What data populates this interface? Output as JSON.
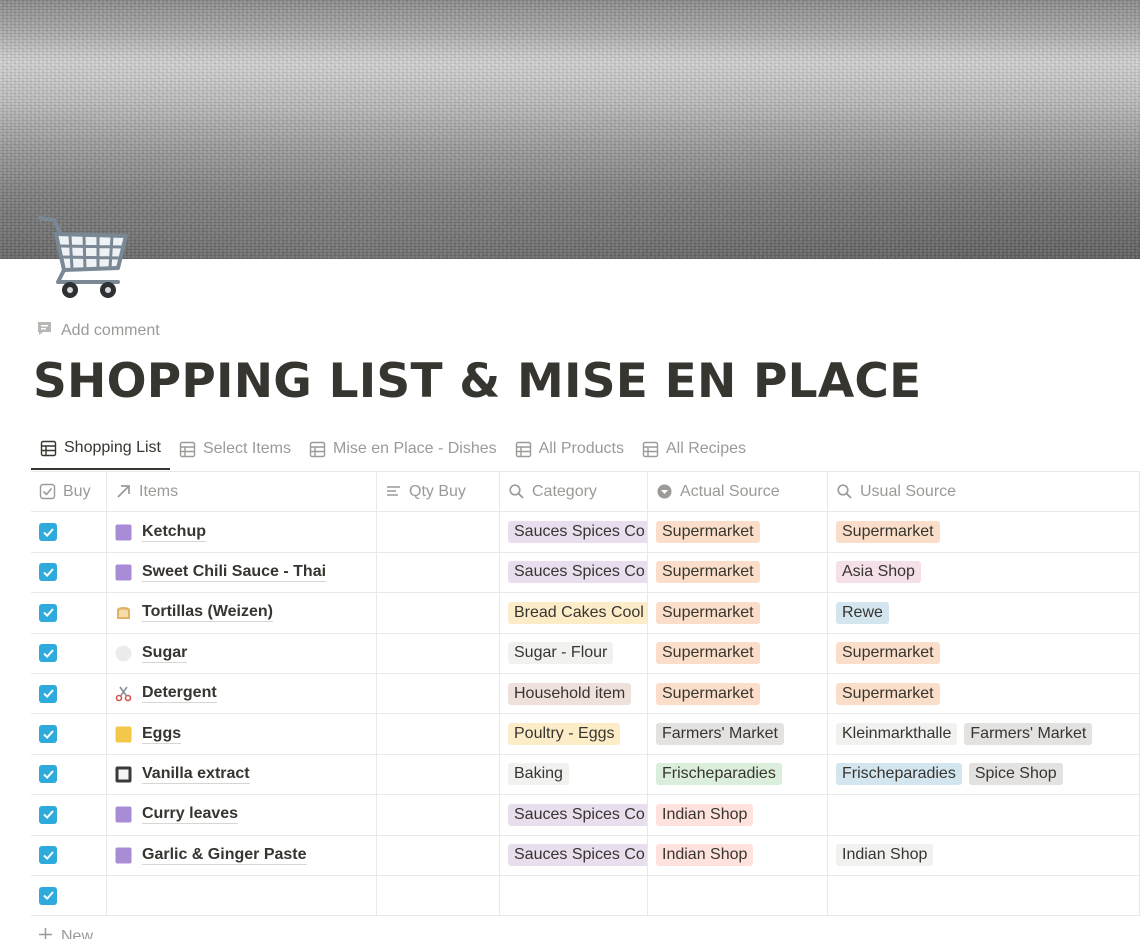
{
  "page": {
    "title": "SHOPPING LIST & MISE EN PLACE",
    "add_comment": "Add comment",
    "icon": "shopping-cart-icon"
  },
  "tabs": [
    {
      "label": "Shopping List",
      "active": true
    },
    {
      "label": "Select Items",
      "active": false
    },
    {
      "label": "Mise en Place - Dishes",
      "active": false
    },
    {
      "label": "All Products",
      "active": false
    },
    {
      "label": "All Recipes",
      "active": false
    }
  ],
  "columns": {
    "buy": "Buy",
    "items": "Items",
    "qty": "Qty Buy",
    "category": "Category",
    "actual_source": "Actual Source",
    "usual_source": "Usual Source"
  },
  "colors": {
    "purple": "#e8deee",
    "orange": "#fadec9",
    "pink": "#f5e0e9",
    "blue": "#d3e5ef",
    "gray": "#e3e2e0",
    "lightgray": "#f1f1ef",
    "yellow": "#fdecc8",
    "brown": "#eee0da",
    "green": "#dbeddb",
    "red": "#ffe2dd",
    "checkbox": "#2eaadc"
  },
  "rows": [
    {
      "buy": true,
      "icon": "purple-square-icon",
      "name": "Ketchup",
      "category": {
        "text": "Sauces Spices Co",
        "color": "purple"
      },
      "actual": [
        {
          "text": "Supermarket",
          "color": "orange"
        }
      ],
      "usual": [
        {
          "text": "Supermarket",
          "color": "orange"
        }
      ]
    },
    {
      "buy": true,
      "icon": "purple-square-icon",
      "name": "Sweet Chili Sauce - Thai",
      "category": {
        "text": "Sauces Spices Co",
        "color": "purple"
      },
      "actual": [
        {
          "text": "Supermarket",
          "color": "orange"
        }
      ],
      "usual": [
        {
          "text": "Asia Shop",
          "color": "pink"
        }
      ]
    },
    {
      "buy": true,
      "icon": "bread-icon",
      "name": "Tortillas (Weizen)",
      "category": {
        "text": "Bread Cakes Cool",
        "color": "yellow"
      },
      "actual": [
        {
          "text": "Supermarket",
          "color": "orange"
        }
      ],
      "usual": [
        {
          "text": "Rewe",
          "color": "blue"
        }
      ]
    },
    {
      "buy": true,
      "icon": "white-circle-icon",
      "name": "Sugar",
      "category": {
        "text": "Sugar - Flour",
        "color": "lightgray"
      },
      "actual": [
        {
          "text": "Supermarket",
          "color": "orange"
        }
      ],
      "usual": [
        {
          "text": "Supermarket",
          "color": "orange"
        }
      ]
    },
    {
      "buy": true,
      "icon": "scissors-icon",
      "name": "Detergent",
      "category": {
        "text": "Household item",
        "color": "brown"
      },
      "actual": [
        {
          "text": "Supermarket",
          "color": "orange"
        }
      ],
      "usual": [
        {
          "text": "Supermarket",
          "color": "orange"
        }
      ]
    },
    {
      "buy": true,
      "icon": "yellow-square-icon",
      "name": "Eggs",
      "category": {
        "text": "Poultry - Eggs",
        "color": "yellow"
      },
      "actual": [
        {
          "text": "Farmers' Market",
          "color": "gray"
        }
      ],
      "usual": [
        {
          "text": "Kleinmarkthalle",
          "color": "lightgray"
        },
        {
          "text": "Farmers' Market",
          "color": "gray"
        }
      ]
    },
    {
      "buy": true,
      "icon": "black-square-button-icon",
      "name": "Vanilla extract",
      "category": {
        "text": "Baking",
        "color": "lightgray"
      },
      "actual": [
        {
          "text": "Frischeparadies",
          "color": "green"
        }
      ],
      "usual": [
        {
          "text": "Frischeparadies",
          "color": "blue"
        },
        {
          "text": "Spice Shop",
          "color": "gray"
        }
      ]
    },
    {
      "buy": true,
      "icon": "purple-square-icon",
      "name": "Curry leaves",
      "category": {
        "text": "Sauces Spices Co",
        "color": "purple"
      },
      "actual": [
        {
          "text": "Indian Shop",
          "color": "red"
        }
      ],
      "usual": []
    },
    {
      "buy": true,
      "icon": "purple-square-icon",
      "name": "Garlic & Ginger Paste",
      "category": {
        "text": "Sauces Spices Co",
        "color": "purple"
      },
      "actual": [
        {
          "text": "Indian Shop",
          "color": "red"
        }
      ],
      "usual": [
        {
          "text": "Indian Shop",
          "color": "lightgray"
        }
      ]
    },
    {
      "buy": true,
      "icon": "",
      "name": "",
      "category": null,
      "actual": [],
      "usual": []
    }
  ],
  "new_row_label": "New"
}
